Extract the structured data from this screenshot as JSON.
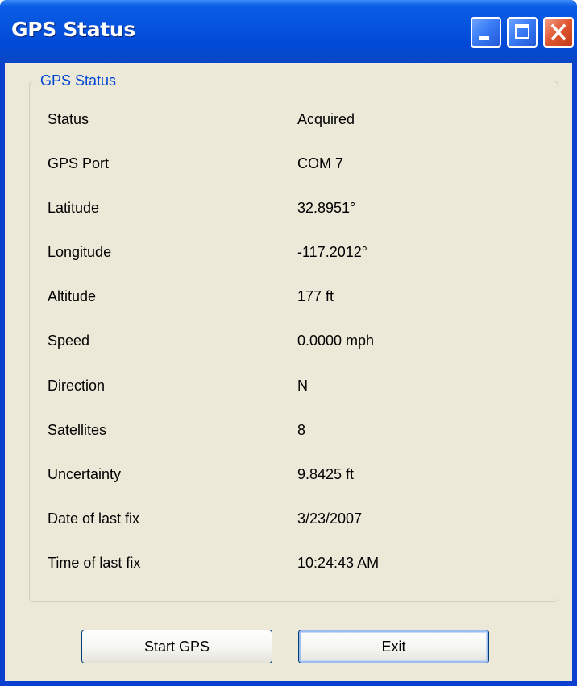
{
  "window": {
    "title": "GPS Status"
  },
  "groupbox": {
    "title": "GPS Status"
  },
  "fields": [
    {
      "label": "Status",
      "value": "Acquired"
    },
    {
      "label": "GPS Port",
      "value": "COM 7"
    },
    {
      "label": "Latitude",
      "value": "32.8951°"
    },
    {
      "label": "Longitude",
      "value": "-117.2012°"
    },
    {
      "label": "Altitude",
      "value": "177 ft"
    },
    {
      "label": "Speed",
      "value": "0.0000 mph"
    },
    {
      "label": "Direction",
      "value": "N"
    },
    {
      "label": "Satellites",
      "value": "8"
    },
    {
      "label": "Uncertainty",
      "value": "9.8425 ft"
    },
    {
      "label": "Date of last fix",
      "value": "3/23/2007"
    },
    {
      "label": "Time of last fix",
      "value": "10:24:43 AM"
    }
  ],
  "buttons": {
    "start_label": "Start GPS",
    "exit_label": "Exit"
  },
  "colors": {
    "titlebar": "#0653dd",
    "client_background": "#ece9d8",
    "group_title": "#0046d5",
    "close_button": "#e0552f"
  },
  "icons": {
    "minimize": "minimize-icon",
    "maximize": "maximize-icon",
    "close": "close-icon"
  }
}
